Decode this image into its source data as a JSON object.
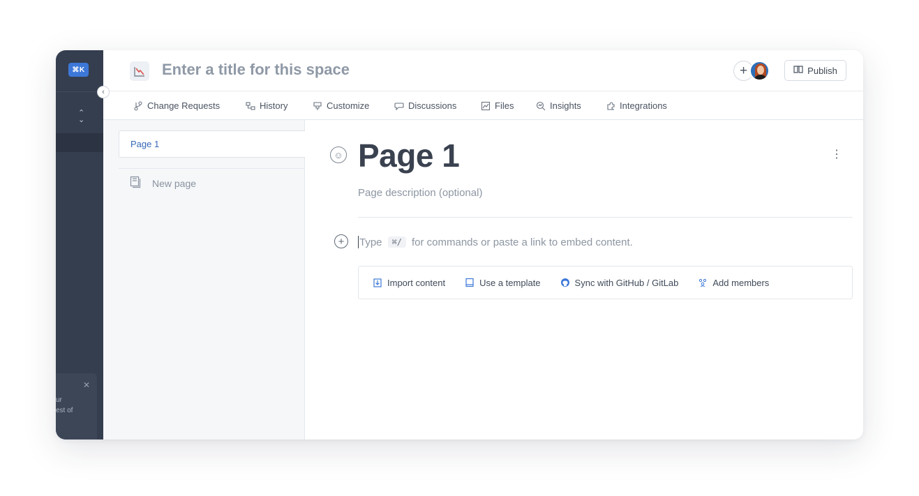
{
  "sidebar": {
    "shortcut_badge": "⌘K",
    "switcher_icon": "chevron-up-down-icon",
    "card": {
      "close_icon": "close-icon",
      "text": "ur\nest of"
    },
    "collapse_icon": "chevron-left-icon"
  },
  "header": {
    "space_icon": "chart-down-icon",
    "title": "Enter a title for this space",
    "add_icon": "plus-icon",
    "publish_label": "Publish",
    "publish_icon": "book-open-icon"
  },
  "tabs": [
    {
      "label": "Change Requests",
      "icon": "branch-icon"
    },
    {
      "label": "History",
      "icon": "history-icon"
    },
    {
      "label": "Customize",
      "icon": "brush-icon"
    },
    {
      "label": "Discussions",
      "icon": "chat-bubble-icon"
    },
    {
      "label": "Files",
      "icon": "files-icon"
    },
    {
      "label": "Insights",
      "icon": "insights-icon"
    },
    {
      "label": "Integrations",
      "icon": "puzzle-icon"
    }
  ],
  "tree": {
    "pages": [
      {
        "label": "Page 1"
      }
    ],
    "new_page_label": "New page"
  },
  "editor": {
    "title": "Page 1",
    "description_placeholder": "Page description (optional)",
    "hint_before": "Type",
    "hint_key": "⌘/",
    "hint_after": "for commands or paste a link to embed content.",
    "actions": [
      {
        "label": "Import content",
        "icon": "import-icon"
      },
      {
        "label": "Use a template",
        "icon": "template-icon"
      },
      {
        "label": "Sync with GitHub / GitLab",
        "icon": "github-icon"
      },
      {
        "label": "Add members",
        "icon": "members-icon"
      }
    ]
  },
  "colors": {
    "sidebar": "#353e4f",
    "accent": "#3d78d8",
    "link": "#3669b7"
  }
}
